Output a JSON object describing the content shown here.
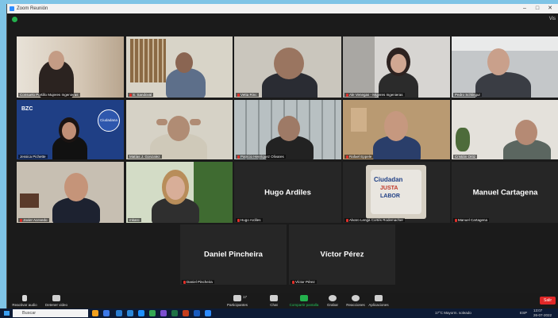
{
  "window": {
    "title": "Zoom Reunión",
    "controls": [
      "–",
      "□",
      "✕"
    ],
    "view_label": "Vis"
  },
  "tiles": [
    {
      "name": "Consuelo Portillo Mujeres Ingenieras",
      "muted": false
    },
    {
      "name": "S. Sandoval",
      "muted": true
    },
    {
      "name": "Vetta Rinc",
      "muted": true
    },
    {
      "name": "Ale Venegas - Mujeres Ingenieras",
      "muted": true
    },
    {
      "name": "Pedro Schlingur",
      "muted": false
    },
    {
      "name": "Jessica Pichette",
      "muted": false
    },
    {
      "name": "Matías J. Gonzalez",
      "muted": false
    },
    {
      "name": "Patricio Henríquez Olivares",
      "muted": true
    },
    {
      "name": "Rafael Eppele",
      "muted": true
    },
    {
      "name": "Cristián Ortiz",
      "muted": false
    },
    {
      "name": "Javier Acevedo",
      "muted": true
    },
    {
      "name": "mkaro",
      "muted": false
    },
    {
      "name": "Hugo Ardiles",
      "big": "Hugo Ardiles",
      "muted": true
    },
    {
      "name": "Alvaro Lenga Cortés Rodemacher",
      "muted": true
    },
    {
      "name": "Manuel Cartagena",
      "big": "Manuel Cartagena",
      "muted": true
    },
    {
      "name": "Daniel Pincheira",
      "big": "Daniel Pincheira",
      "muted": true
    },
    {
      "name": "Víctor Pérez",
      "big": "Víctor Pérez",
      "muted": true
    }
  ],
  "slide": {
    "brand": "BZC",
    "badge": "Ciudadana"
  },
  "poster": {
    "line1": "Ciudadan",
    "line2": "JUSTA",
    "line3": "LABOR"
  },
  "controls": {
    "audio": "Reactivar audio",
    "video": "Detener video",
    "participants": "Participantes",
    "participants_count": "17",
    "chat": "Chat",
    "share": "Compartir pantalla",
    "record": "Grabar",
    "reactions": "Reacciones",
    "apps": "Aplicaciones",
    "leave": "Salir"
  },
  "taskbar": {
    "search": "Buscar",
    "weather": "17°C  Mayorm. soleado",
    "lang": "ESP",
    "time": "13:07",
    "date": "26-07-2022"
  }
}
